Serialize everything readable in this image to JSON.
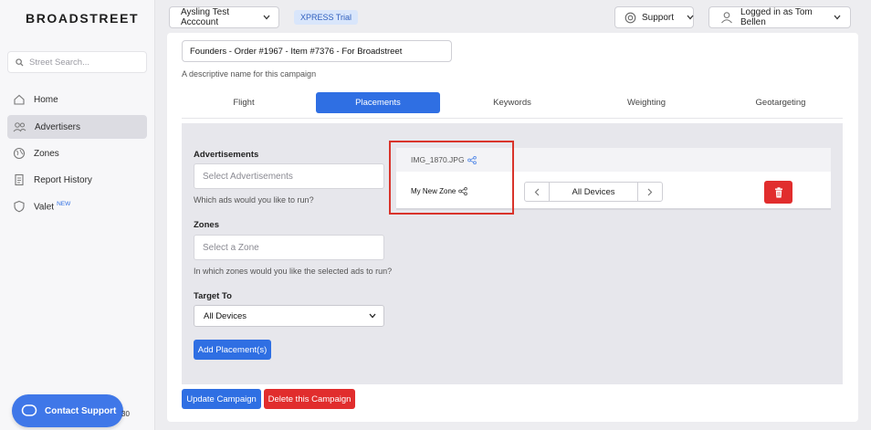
{
  "app": {
    "logo": "BROADSTREET"
  },
  "sidebar": {
    "search_placeholder": "Street Search...",
    "items": [
      {
        "label": "Home",
        "icon": "home-icon"
      },
      {
        "label": "Advertisers",
        "icon": "users-icon",
        "active": true
      },
      {
        "label": "Zones",
        "icon": "globe-icon"
      },
      {
        "label": "Report History",
        "icon": "report-icon"
      },
      {
        "label": "Valet",
        "icon": "shield-icon",
        "badge": "NEW"
      }
    ],
    "contact_support": "Contact Support",
    "footer_number": "30"
  },
  "header": {
    "account_name": "Aysling Test Acccount",
    "trial_badge": "XPRESS Trial",
    "support_label": "Support",
    "user_label": "Logged in as Tom Bellen"
  },
  "campaign": {
    "name": "Founders - Order #1967 - Item #7376 - For Broadstreet",
    "name_hint": "A descriptive name for this campaign",
    "tabs": [
      "Flight",
      "Placements",
      "Keywords",
      "Weighting",
      "Geotargeting"
    ],
    "active_tab": "Placements"
  },
  "placement_form": {
    "ads_label": "Advertisements",
    "ads_placeholder": "Select Advertisements",
    "ads_hint": "Which ads would you like to run?",
    "zones_label": "Zones",
    "zones_placeholder": "Select a Zone",
    "zones_hint": "In which zones would you like the selected ads to run?",
    "target_label": "Target To",
    "target_value": "All Devices",
    "add_button": "Add Placement(s)"
  },
  "placement_list": {
    "ad_name": "IMG_1870.JPG",
    "zone_name": "My New Zone",
    "device_value": "All Devices"
  },
  "actions": {
    "update": "Update Campaign",
    "delete": "Delete this Campaign"
  },
  "colors": {
    "primary": "#2f6fe3",
    "danger": "#e12d2d",
    "highlight": "#d9342b"
  }
}
